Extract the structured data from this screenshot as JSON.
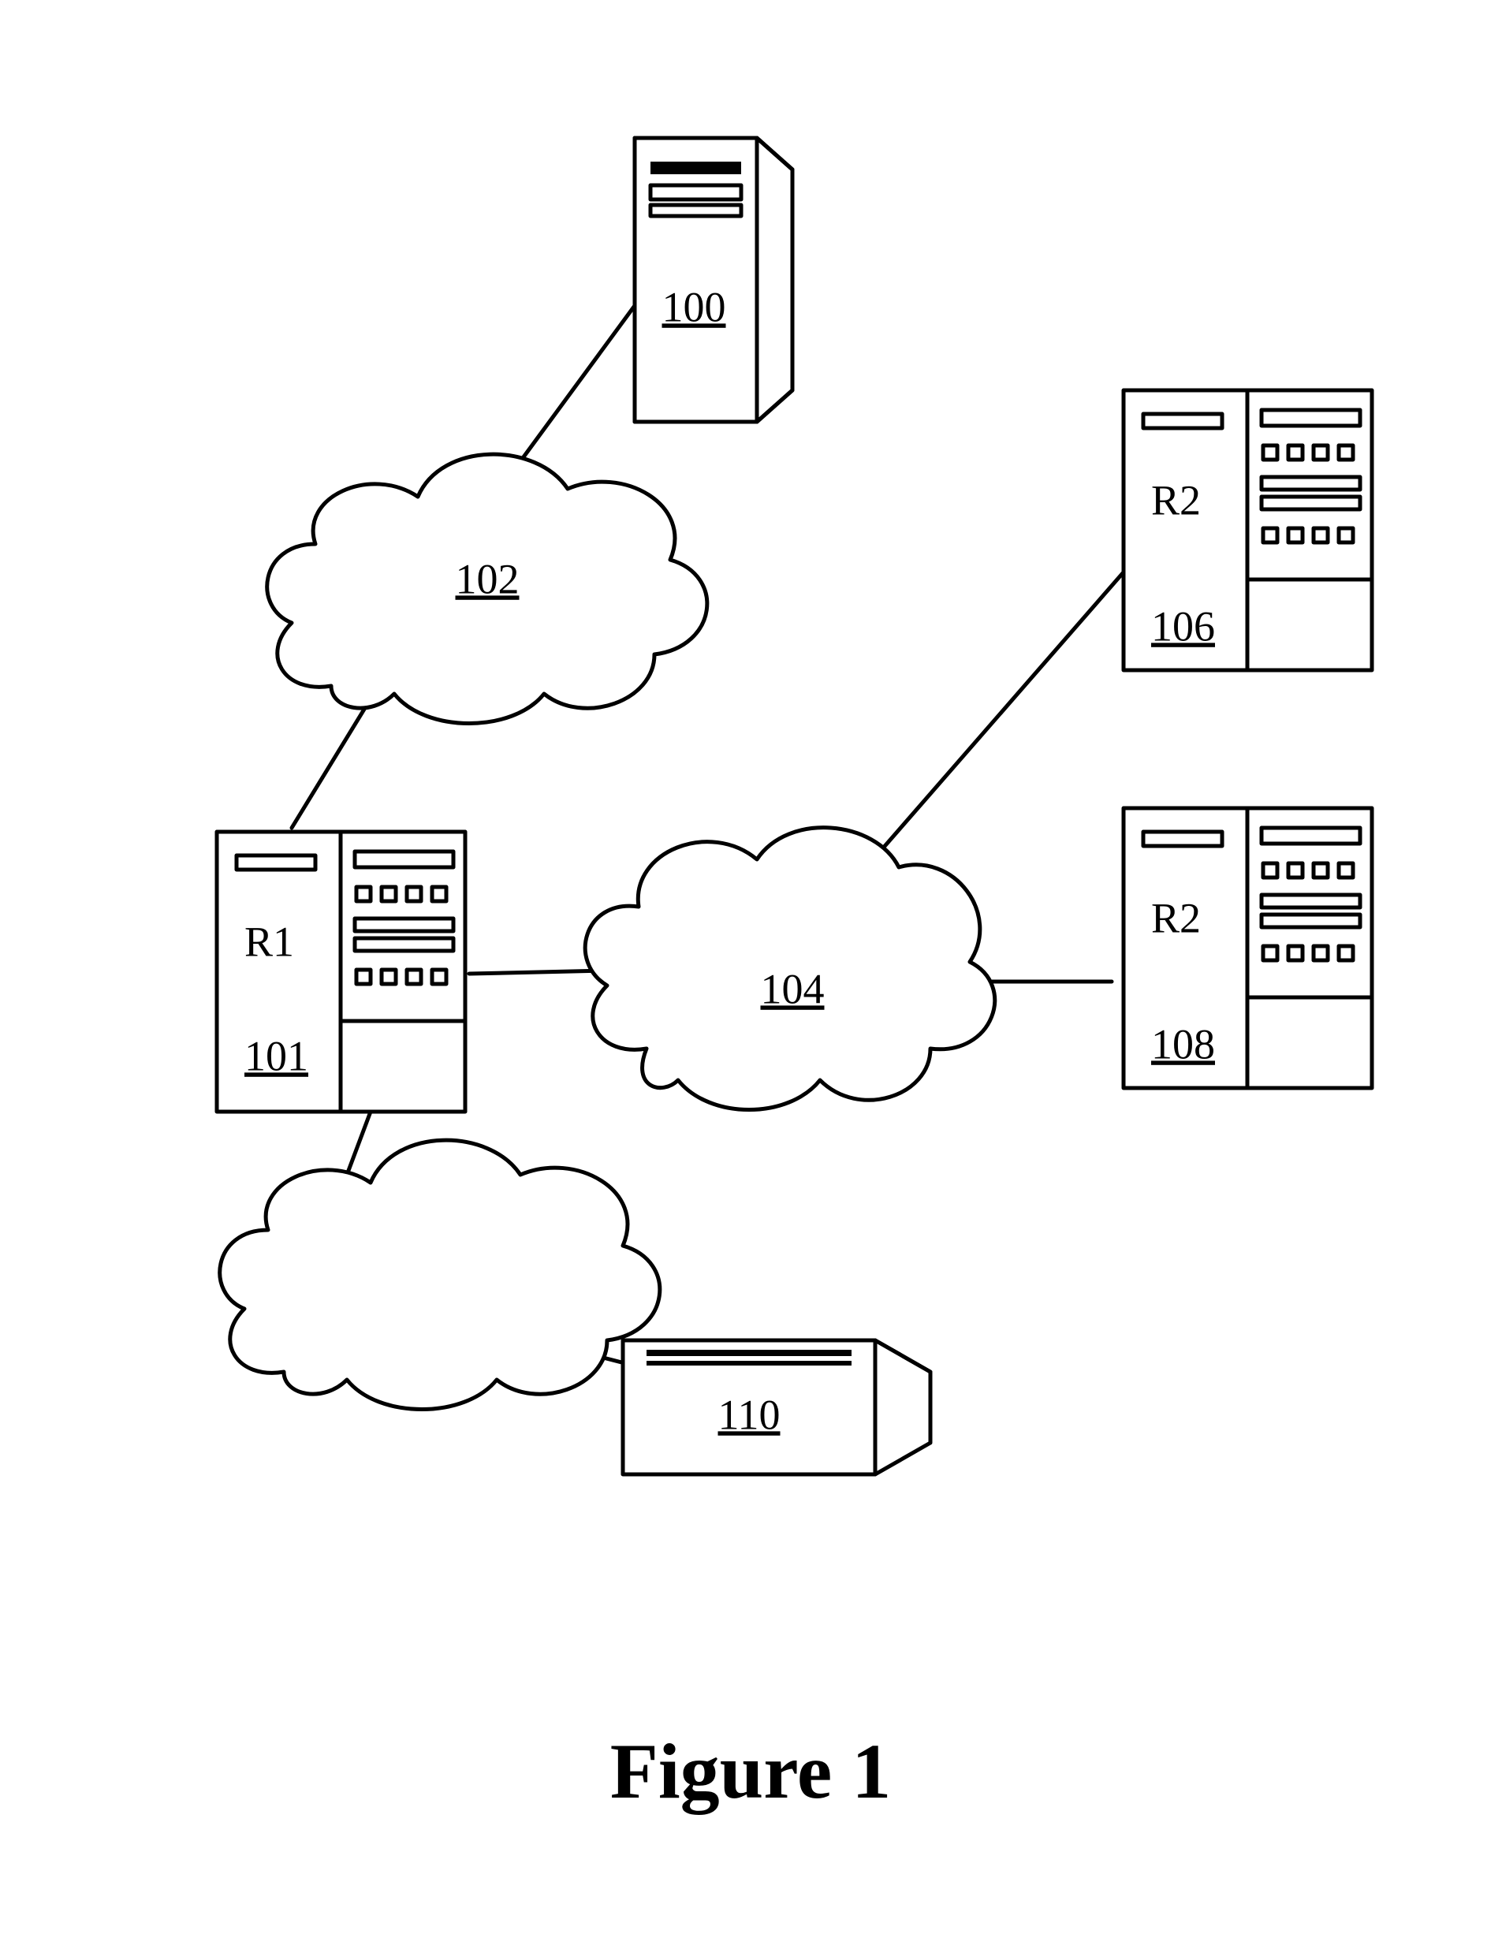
{
  "figure_label": "Figure 1",
  "nodes": {
    "server_100": {
      "label": "100"
    },
    "cloud_102": {
      "label": "102"
    },
    "cloud_104": {
      "label": "104"
    },
    "device_110": {
      "label": "110"
    },
    "r1": {
      "name": "R1",
      "label": "101"
    },
    "r2_upper": {
      "name": "R2",
      "label": "106"
    },
    "r2_lower": {
      "name": "R2",
      "label": "108"
    }
  }
}
